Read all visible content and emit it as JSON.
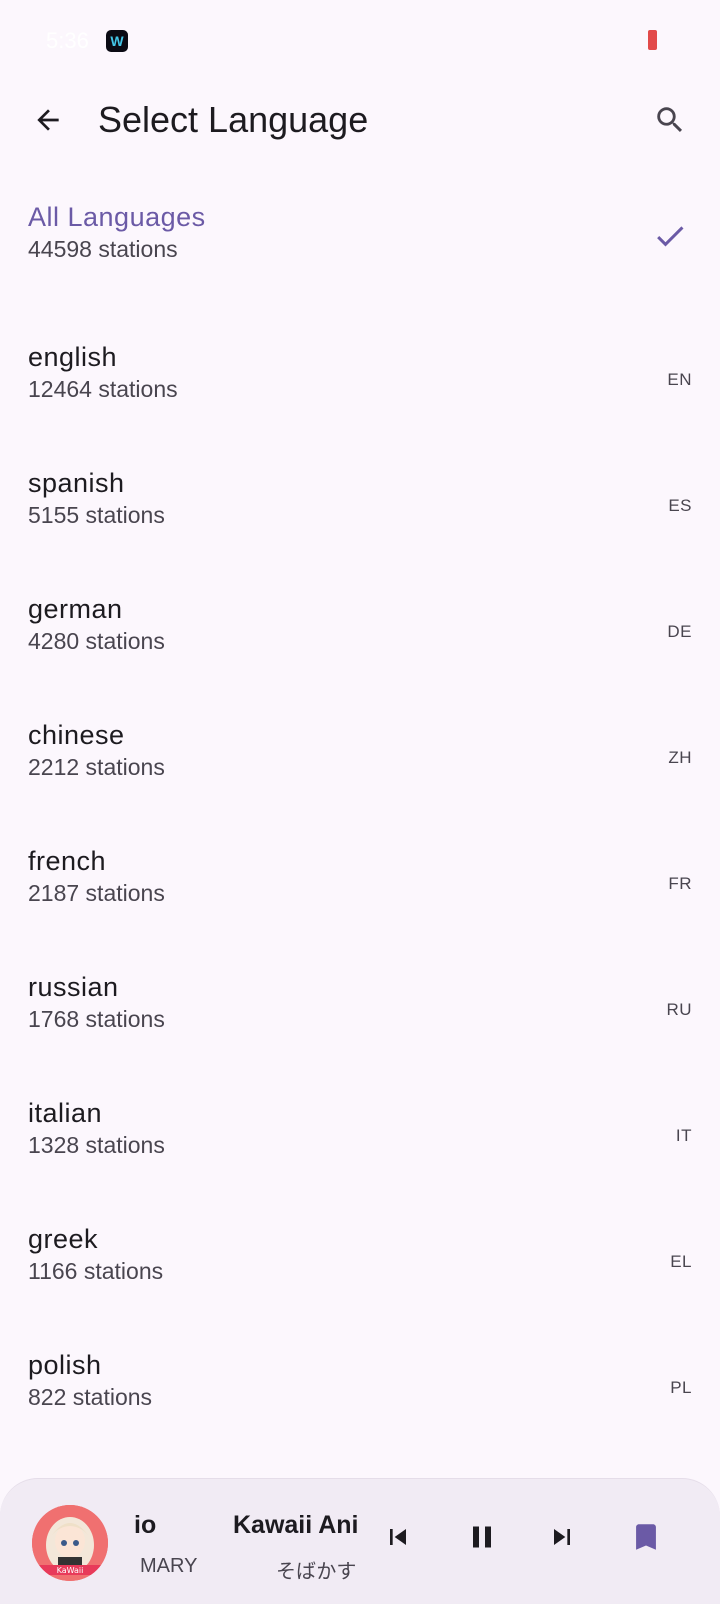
{
  "status_bar": {
    "time": "5:36"
  },
  "toolbar": {
    "title": "Select Language"
  },
  "languages": [
    {
      "name": "All Languages",
      "count": "44598 stations",
      "code": "",
      "selected": true
    },
    {
      "name": "english",
      "count": "12464 stations",
      "code": "EN"
    },
    {
      "name": "spanish",
      "count": "5155 stations",
      "code": "ES"
    },
    {
      "name": "german",
      "count": "4280 stations",
      "code": "DE"
    },
    {
      "name": "chinese",
      "count": "2212 stations",
      "code": "ZH"
    },
    {
      "name": "french",
      "count": "2187 stations",
      "code": "FR"
    },
    {
      "name": "russian",
      "count": "1768 stations",
      "code": "RU"
    },
    {
      "name": "italian",
      "count": "1328 stations",
      "code": "IT"
    },
    {
      "name": "greek",
      "count": "1166 stations",
      "code": "EL"
    },
    {
      "name": "polish",
      "count": "822 stations",
      "code": "PL"
    }
  ],
  "player": {
    "title_a": "io",
    "subtitle_a": "MARY",
    "title_b": "Kawaii Anime",
    "subtitle_b": "そばかす",
    "art_label": "KaWaii"
  },
  "icons": {
    "back": "arrow-left-icon",
    "search": "search-icon",
    "check": "check-icon",
    "prev": "skip-previous-icon",
    "pause": "pause-icon",
    "next": "skip-next-icon",
    "bookmark": "bookmark-icon"
  },
  "colors": {
    "accent": "#6b5aa6",
    "background": "#fcf7fd",
    "player_bg": "#f1ebf4"
  }
}
